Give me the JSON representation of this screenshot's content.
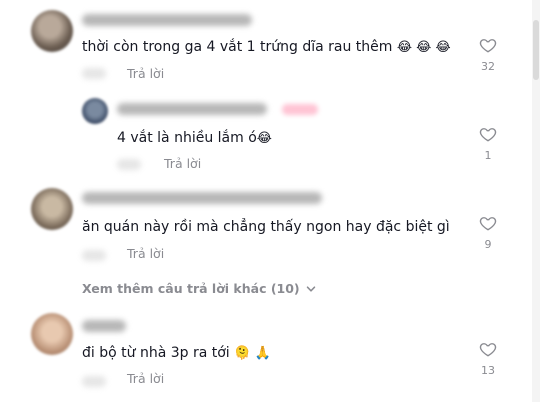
{
  "comments": [
    {
      "text": "thời còn trong ga 4 vắt 1 trứng dĩa rau thêm",
      "emoji": "😂 😂 😂",
      "reply_label": "Trả lời",
      "likes": "32"
    },
    {
      "text": "4 vắt là nhiều lắm ó",
      "emoji": "😂",
      "reply_label": "Trả lời",
      "likes": "1"
    },
    {
      "text": "ăn quán này rồi mà chẳng thấy ngon hay đặc biệt gì",
      "emoji": "",
      "reply_label": "Trả lời",
      "likes": "9"
    },
    {
      "text": "đi bộ từ nhà 3p ra tới",
      "emoji": "🫠 🙏",
      "reply_label": "Trả lời",
      "likes": "13"
    }
  ],
  "more_replies": "Xem thêm câu trả lời khác (10)",
  "icons": {
    "like": "heart-outline-icon",
    "expand": "chevron-down-icon"
  },
  "colors": {
    "text": "#161823",
    "secondary": "#8a8b91"
  }
}
